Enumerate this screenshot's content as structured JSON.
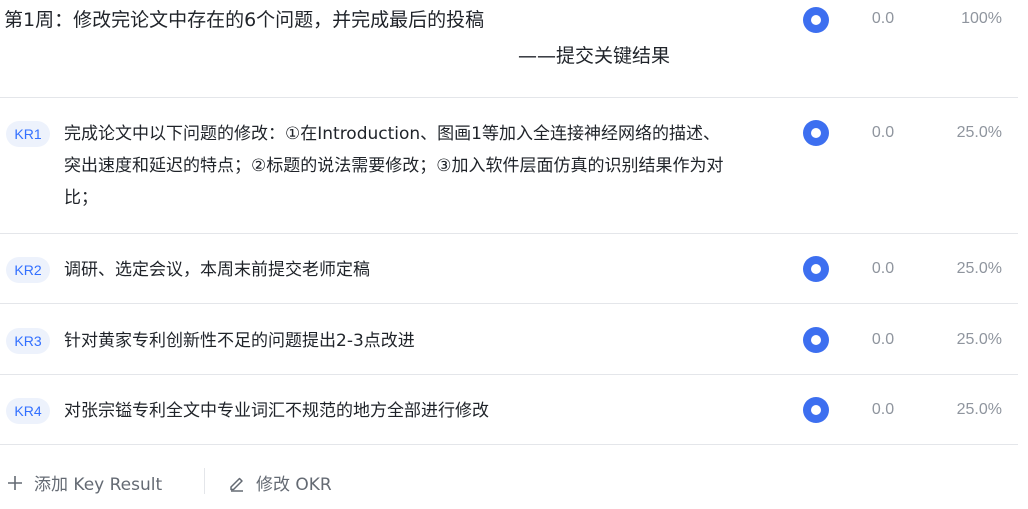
{
  "objective": {
    "title": "第1周：修改完论文中存在的6个问题，并完成最后的投稿",
    "subtitle": "——提交关键结果",
    "score": "0.0",
    "weight": "100%",
    "status_color": "#3d6ff0"
  },
  "key_results": [
    {
      "badge": "KR1",
      "text": "完成论文中以下问题的修改：①在Introduction、图画1等加入全连接神经网络的描述、突出速度和延迟的特点；②标题的说法需要修改；③加入软件层面仿真的识别结果作为对比；",
      "score": "0.0",
      "weight": "25.0%"
    },
    {
      "badge": "KR2",
      "text": "调研、选定会议，本周末前提交老师定稿",
      "score": "0.0",
      "weight": "25.0%"
    },
    {
      "badge": "KR3",
      "text": "针对黄家专利创新性不足的问题提出2-3点改进",
      "score": "0.0",
      "weight": "25.0%"
    },
    {
      "badge": "KR4",
      "text": "对张宗镒专利全文中专业词汇不规范的地方全部进行修改",
      "score": "0.0",
      "weight": "25.0%"
    }
  ],
  "footer": {
    "add_label": "添加 Key Result",
    "add_icon": "plus-icon",
    "edit_label": "修改 OKR",
    "edit_icon": "pencil-icon"
  },
  "colors": {
    "accent": "#3370ff",
    "badge_bg": "#edf2fc",
    "divider": "#e4e6ea",
    "muted_text": "#8f959e"
  }
}
